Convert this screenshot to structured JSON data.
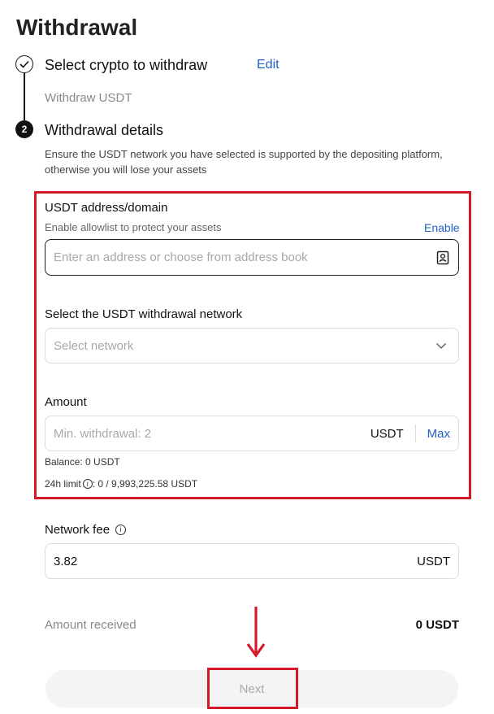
{
  "page": {
    "title": "Withdrawal"
  },
  "step1": {
    "number": "",
    "title": "Select crypto to withdraw",
    "edit_label": "Edit",
    "selection": "Withdraw USDT"
  },
  "step2": {
    "number": "2",
    "title": "Withdrawal details",
    "notice": "Ensure the USDT network you have selected is supported by the depositing platform, otherwise you will lose your assets"
  },
  "address": {
    "label": "USDT address/domain",
    "allowlist_text": "Enable allowlist to protect your assets",
    "enable_label": "Enable",
    "placeholder": "Enter an address or choose from address book",
    "value": ""
  },
  "network": {
    "label": "Select the USDT withdrawal network",
    "placeholder": "Select network"
  },
  "amount": {
    "label": "Amount",
    "placeholder": "Min. withdrawal: 2",
    "unit": "USDT",
    "max_label": "Max",
    "balance": "Balance: 0 USDT",
    "limit_label": "24h limit",
    "limit_value": ": 0 / 9,993,225.58 USDT",
    "info_glyph": "i"
  },
  "fee": {
    "label": "Network fee",
    "info_glyph": "i",
    "value": "3.82",
    "unit": "USDT"
  },
  "received": {
    "label": "Amount received",
    "value": "0 USDT"
  },
  "next_button": {
    "label": "Next"
  },
  "colors": {
    "highlight_red": "#d5192b",
    "link_blue": "#2060c8"
  }
}
